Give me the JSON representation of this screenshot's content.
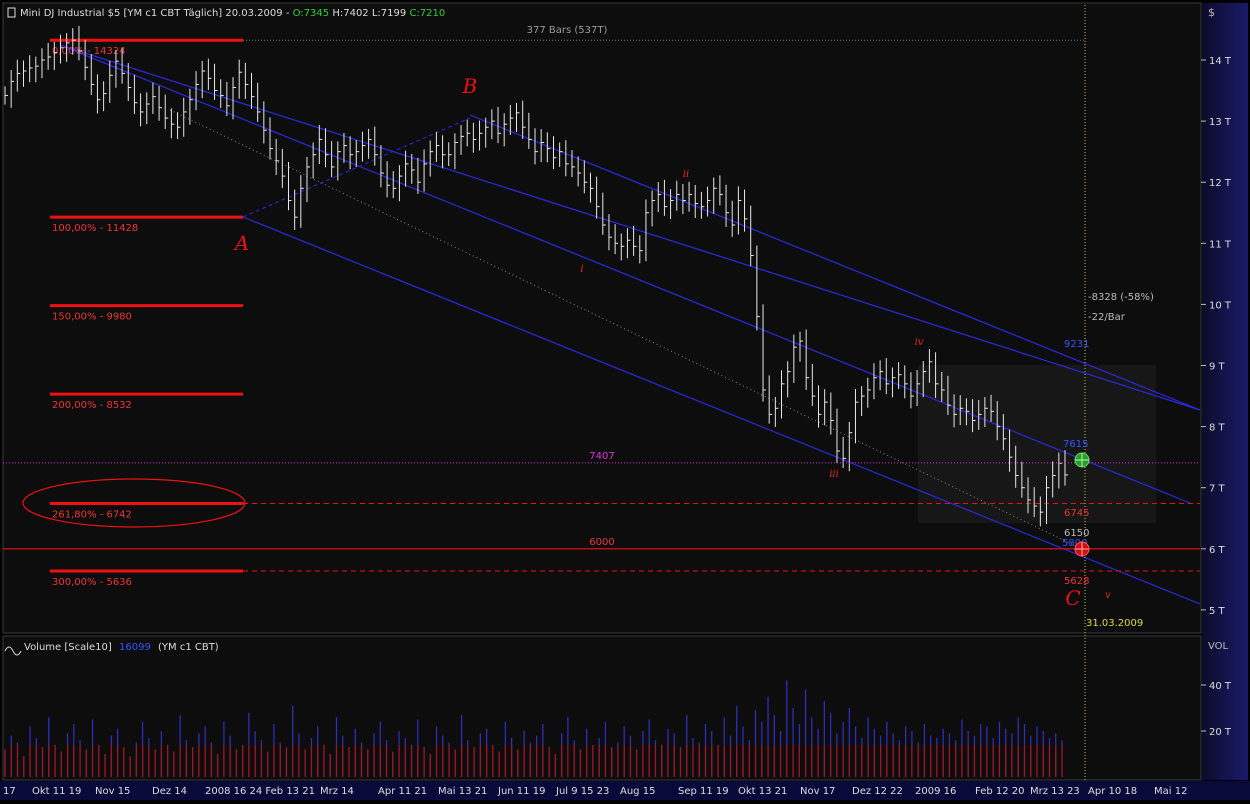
{
  "header": {
    "instrument": "Mini DJ Industrial $5 [YM c1 CBT  Täglich] 20.03.2009 -",
    "open_label": "O:7345",
    "high_label": "H:7402",
    "low_label": "L:7199",
    "close_label": "C:7210",
    "bars_note": "377 Bars (537T)"
  },
  "y_axis": {
    "currency": "$",
    "ticks": [
      {
        "label": "14 T",
        "value": 14000
      },
      {
        "label": "13 T",
        "value": 13000
      },
      {
        "label": "12 T",
        "value": 12000
      },
      {
        "label": "11 T",
        "value": 11000
      },
      {
        "label": "10 T",
        "value": 10000
      },
      {
        "label": "9 T",
        "value": 9000
      },
      {
        "label": "8 T",
        "value": 8000
      },
      {
        "label": "7 T",
        "value": 7000
      },
      {
        "label": "6 T",
        "value": 6000
      },
      {
        "label": "5 T",
        "value": 5000
      }
    ]
  },
  "x_axis": {
    "labels": [
      "17",
      "Okt 11 19",
      "Nov 15",
      "Dez 14",
      "2008 16 24 Feb 13 21",
      "Mrz 14",
      "Apr 11 21",
      "Mai 13 21",
      "Jun 11 19",
      "Jul 9 15 23",
      "Aug 15",
      "Sep 11 19",
      "Okt 13 21",
      "Nov 17",
      "Dez 12 22",
      "2009 16",
      "Feb 12 20",
      "Mrz 13 23",
      "Apr 10 18",
      "Mai 12"
    ]
  },
  "fib_levels": [
    {
      "label": "0,00% - 14324",
      "value": 14324
    },
    {
      "label": "100,00% - 11428",
      "value": 11428
    },
    {
      "label": "150,00% - 9980",
      "value": 9980
    },
    {
      "label": "200,00% - 8532",
      "value": 8532
    },
    {
      "label": "261,80% - 6742",
      "value": 6742
    },
    {
      "label": "300,00% - 5636",
      "value": 5636
    }
  ],
  "waves": [
    {
      "label": "A",
      "price": 11428
    },
    {
      "label": "B",
      "price": 13136
    },
    {
      "label": "C",
      "price": 5500
    }
  ],
  "sub_waves": [
    {
      "label": "i",
      "price": 10880
    },
    {
      "label": "ii",
      "price": 11800
    },
    {
      "label": "iii",
      "price": 7480
    },
    {
      "label": "iv",
      "price": 9060
    },
    {
      "label": "v",
      "price": 5150
    }
  ],
  "annotations": {
    "pink_level_label": "7407",
    "pink_level_value": 7407,
    "red_level_label": "6000",
    "red_level_value": 6000,
    "change_text": "-8328 (-58%)",
    "per_bar_text": "-22/Bar",
    "upper_channel_label": "9231",
    "middle_channel_label": "7615",
    "lower_channel_label": "5800",
    "dash_level_label": "6745",
    "current_label": "6150",
    "target_label": "5628",
    "target_date": "31.03.2009"
  },
  "volume_panel": {
    "title": "Volume [Scale10]",
    "value_label": "16099",
    "instrument_label": "(YM c1 CBT)",
    "axis_title": "VOL",
    "ticks": [
      {
        "label": "40 T",
        "value": 40000
      },
      {
        "label": "20 T",
        "value": 20000
      }
    ]
  },
  "chart_data": {
    "type": "ohlc",
    "ylim": [
      4700,
      15200
    ],
    "price_closes": [
      13420,
      13650,
      13780,
      13820,
      13870,
      13900,
      14000,
      14050,
      14120,
      14200,
      14280,
      14324,
      14150,
      13880,
      13600,
      13350,
      13450,
      13750,
      13980,
      13780,
      13550,
      13300,
      13150,
      13280,
      13400,
      13220,
      13050,
      12950,
      12900,
      13150,
      13350,
      13600,
      13820,
      13700,
      13500,
      13420,
      13250,
      13550,
      13800,
      13600,
      13400,
      13150,
      12850,
      12550,
      12350,
      12100,
      11700,
      11428,
      11900,
      12250,
      12450,
      12700,
      12450,
      12250,
      12500,
      12600,
      12450,
      12500,
      12600,
      12700,
      12450,
      12150,
      11950,
      11900,
      12100,
      12300,
      12200,
      12000,
      12300,
      12500,
      12600,
      12450,
      12450,
      12650,
      12750,
      12800,
      12700,
      12800,
      12900,
      13000,
      12800,
      12950,
      13050,
      13136,
      12900,
      12700,
      12500,
      12650,
      12550,
      12400,
      12500,
      12300,
      12250,
      12150,
      12000,
      11900,
      11600,
      11300,
      11100,
      11000,
      10950,
      11050,
      10950,
      10880,
      11500,
      11700,
      11800,
      11600,
      11700,
      11800,
      11700,
      11800,
      11650,
      11600,
      11700,
      11900,
      11800,
      11500,
      11300,
      11700,
      11400,
      10800,
      9800,
      8600,
      8200,
      8300,
      8700,
      8900,
      9300,
      9400,
      8800,
      8500,
      8200,
      8400,
      8100,
      7600,
      7480,
      7900,
      8400,
      8500,
      8600,
      8800,
      8900,
      8700,
      8800,
      8850,
      8700,
      8500,
      8700,
      8900,
      9060,
      8700,
      8600,
      8350,
      8200,
      8300,
      8250,
      8100,
      8200,
      8300,
      8250,
      8000,
      7800,
      7500,
      7200,
      7000,
      6800,
      6700,
      6600,
      7000,
      7200,
      7400,
      7210
    ],
    "volume_values": [
      12000,
      18000,
      15000,
      9000,
      22000,
      17000,
      13000,
      26000,
      14000,
      11000,
      19000,
      23000,
      16000,
      12000,
      25000,
      14000,
      10000,
      18000,
      21000,
      13000,
      9000,
      15000,
      24000,
      17000,
      12000,
      20000,
      14000,
      11000,
      27000,
      16000,
      13000,
      19000,
      22000,
      15000,
      10000,
      24000,
      18000,
      12000,
      14000,
      28000,
      20000,
      16000,
      11000,
      23000,
      15000,
      13000,
      31000,
      19000,
      12000,
      17000,
      22000,
      14000,
      10000,
      26000,
      18000,
      13000,
      21000,
      15000,
      12000,
      19000,
      24000,
      16000,
      11000,
      20000,
      17000,
      14000,
      25000,
      13000,
      10000,
      22000,
      18000,
      15000,
      12000,
      27000,
      16000,
      13000,
      19000,
      21000,
      14000,
      11000,
      24000,
      17000,
      12000,
      20000,
      15000,
      18000,
      23000,
      13000,
      10000,
      19000,
      26000,
      16000,
      12000,
      21000,
      14000,
      17000,
      24000,
      13000,
      15000,
      22000,
      18000,
      12000,
      20000,
      25000,
      16000,
      14000,
      21000,
      19000,
      13000,
      27000,
      17000,
      15000,
      23000,
      20000,
      14000,
      26000,
      18000,
      31000,
      22000,
      16000,
      29000,
      24000,
      35000,
      27000,
      20000,
      42000,
      30000,
      23000,
      38000,
      26000,
      21000,
      33000,
      28000,
      19000,
      24000,
      30000,
      22000,
      17000,
      26000,
      21000,
      18000,
      24000,
      19000,
      16000,
      22000,
      20000,
      15000,
      23000,
      18000,
      17000,
      21000,
      19000,
      16000,
      25000,
      20000,
      18000,
      23000,
      22000,
      17000,
      24000,
      21000,
      19000,
      26000,
      23000,
      18000,
      22000,
      20000,
      17000,
      19000,
      16000
    ]
  }
}
